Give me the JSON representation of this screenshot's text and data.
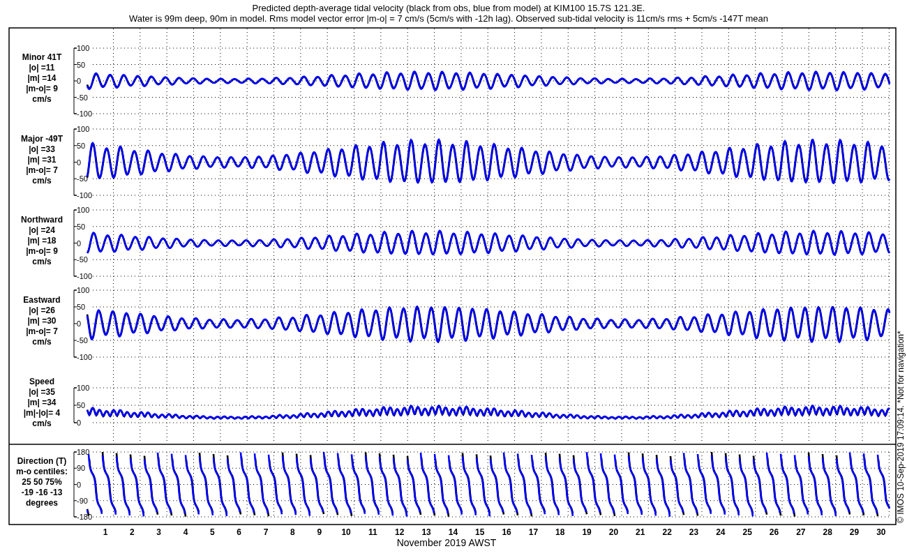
{
  "title_lines": [
    "Predicted depth-average tidal velocity (black from obs, blue from model) at KIM100 15.7S 121.3E.",
    "Water is 99m deep, 90m in model. Rms model vector error |m-o| = 7 cm/s (5cm/s with -12h lag). Observed sub-tidal velocity is 11cm/s rms + 5cm/s -147T mean"
  ],
  "panels": [
    {
      "kind": "minor",
      "label_lines": [
        "Minor 41T",
        "|o| =11",
        "|m| =14",
        "|m-o|= 9",
        "cm/s"
      ],
      "yticks": [
        "100",
        "50",
        "0",
        "-50",
        "-100"
      ]
    },
    {
      "kind": "major",
      "label_lines": [
        "Major -49T",
        "|o| =33",
        "|m| =31",
        "|m-o|= 7",
        "cm/s"
      ],
      "yticks": [
        "100",
        "50",
        "0",
        "-50",
        "-100"
      ]
    },
    {
      "kind": "north",
      "label_lines": [
        "Northward",
        "|o| =24",
        "|m| =18",
        "|m-o|= 9",
        "cm/s"
      ],
      "yticks": [
        "100",
        "50",
        "0",
        "-50",
        "-100"
      ]
    },
    {
      "kind": "east",
      "label_lines": [
        "Eastward",
        "|o| =26",
        "|m| =30",
        "|m-o|= 7",
        "cm/s"
      ],
      "yticks": [
        "100",
        "50",
        "0",
        "-50",
        "-100"
      ]
    },
    {
      "kind": "speed",
      "label_lines": [
        "Speed",
        "|o| =35",
        "|m| =34",
        "|m|-|o|= 4",
        "cm/s"
      ],
      "yticks": [
        "100",
        "50",
        "0"
      ]
    },
    {
      "kind": "direction",
      "label_lines": [
        "Direction (T)",
        "m-o centiles:",
        "25  50  75%",
        "-19 -16 -13",
        "degrees"
      ],
      "yticks": [
        "180",
        "90",
        "0",
        "-90",
        "-180"
      ]
    }
  ],
  "xaxis": {
    "day_labels": [
      "1",
      "2",
      "3",
      "4",
      "5",
      "6",
      "7",
      "8",
      "9",
      "10",
      "11",
      "12",
      "13",
      "14",
      "15",
      "16",
      "17",
      "18",
      "19",
      "20",
      "21",
      "22",
      "23",
      "24",
      "25",
      "26",
      "27",
      "28",
      "29",
      "30"
    ],
    "xlabel": "November 2019 AWST"
  },
  "credit": "© IMOS 10-Sep-2019 17:09:14. *Not for navigation*"
}
